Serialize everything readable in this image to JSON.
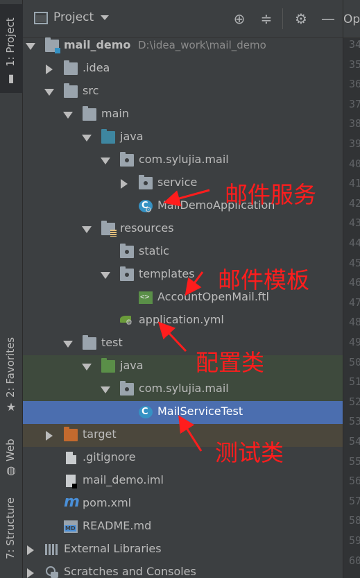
{
  "side_strip": {
    "project": "1: Project",
    "favorites": "2: Favorites",
    "web": "Web",
    "structure": "7: Structure"
  },
  "header": {
    "title": "Project",
    "icons": [
      "crosshair-icon",
      "collapse-icon",
      "gear-icon",
      "minimize-icon"
    ]
  },
  "editor": {
    "tab_label": "Ope",
    "line_numbers": [
      "34",
      "35",
      "36",
      "37",
      "38",
      "39",
      "40",
      "41",
      "42",
      "43",
      "44",
      "45",
      "46",
      "47",
      "48",
      "49",
      "50",
      "51",
      "52",
      "53",
      "54",
      "55",
      "56",
      "57",
      "58",
      "59",
      "60"
    ]
  },
  "tree": {
    "items": [
      {
        "label": "mail_demo",
        "extra": "D:\\idea_work\\mail_demo"
      },
      {
        "label": ".idea"
      },
      {
        "label": "src"
      },
      {
        "label": "main"
      },
      {
        "label": "java"
      },
      {
        "label": "com.sylujia.mail"
      },
      {
        "label": "service"
      },
      {
        "label": "MailDemoApplication"
      },
      {
        "label": "resources"
      },
      {
        "label": "static"
      },
      {
        "label": "templates"
      },
      {
        "label": "AccountOpenMail.ftl"
      },
      {
        "label": "application.yml"
      },
      {
        "label": "test"
      },
      {
        "label": "java"
      },
      {
        "label": "com.sylujia.mail"
      },
      {
        "label": "MailServiceTest"
      },
      {
        "label": "target"
      },
      {
        "label": ".gitignore"
      },
      {
        "label": "mail_demo.iml"
      },
      {
        "label": "pom.xml"
      },
      {
        "label": "README.md"
      },
      {
        "label": "External Libraries"
      },
      {
        "label": "Scratches and Consoles"
      }
    ]
  },
  "annotations": {
    "mail_service": "邮件服务",
    "mail_template": "邮件模板",
    "config_class": "配置类",
    "test_class": "测试类"
  },
  "colors": {
    "panel_bg": "#3c3f41",
    "selection": "#4b6eaf",
    "annotation": "#ff1d1d"
  }
}
